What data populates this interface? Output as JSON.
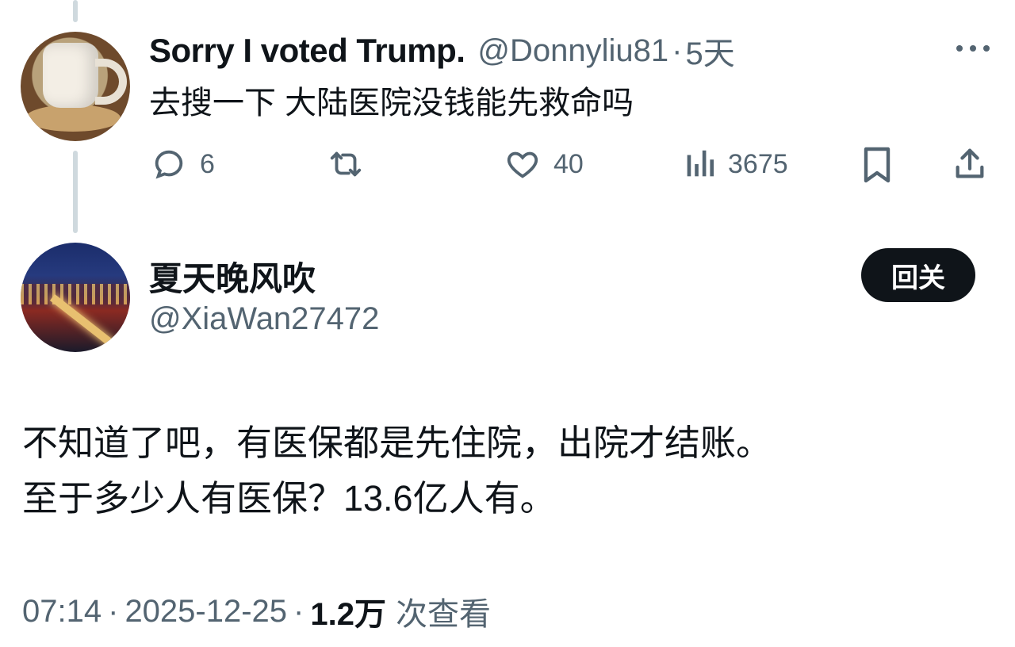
{
  "parent_tweet": {
    "display_name": "Sorry I voted Trump.",
    "handle": "@Donnyliu81",
    "separator": "·",
    "time": "5天",
    "text": "去搜一下 大陆医院没钱能先救命吗",
    "stats": {
      "replies": "6",
      "likes": "40",
      "views": "3675"
    }
  },
  "main_tweet": {
    "display_name": "夏天晚风吹",
    "handle": "@XiaWan27472",
    "follow_label": "回关",
    "lines": [
      "不知道了吧，有医保都是先住院，出院才结账。",
      "至于多少人有医保？13.6亿人有。"
    ],
    "meta": {
      "time": "07:14",
      "sep1": "·",
      "date": "2025-12-25",
      "sep2": "·",
      "views_count": "1.2万",
      "views_label": "次查看"
    }
  },
  "icons": [
    "reply-icon",
    "retweet-icon",
    "like-icon",
    "views-icon",
    "bookmark-icon",
    "share-icon",
    "more-icon"
  ],
  "colors": {
    "text": "#0f1419",
    "secondary": "#536471",
    "thread_line": "#cfd9de",
    "button_bg": "#0f1419"
  }
}
